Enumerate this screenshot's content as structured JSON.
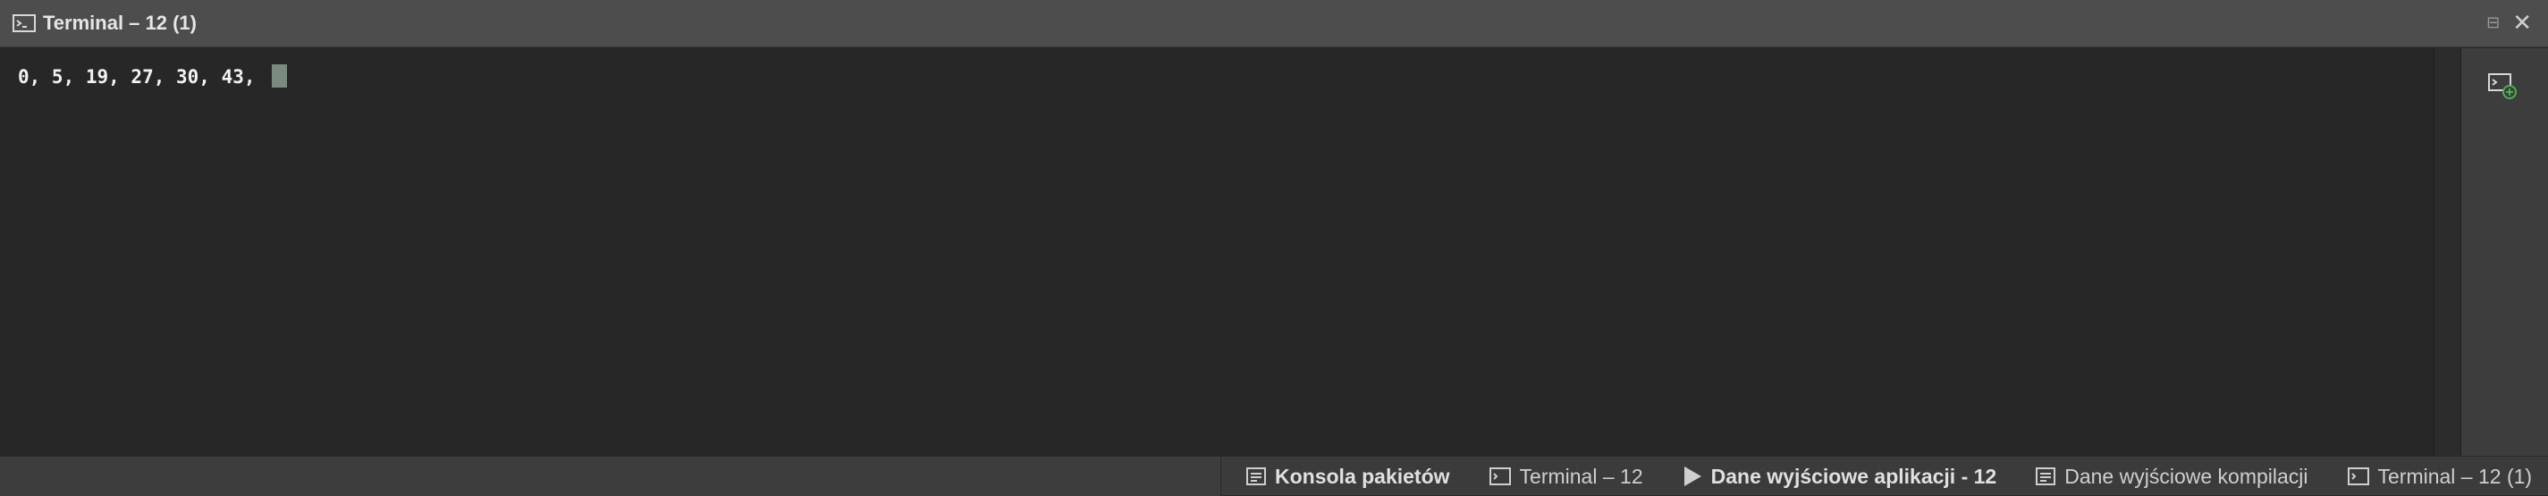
{
  "window": {
    "title": "Terminal – 12 (1)",
    "pin_glyph": "⊟",
    "close_glyph": "✕"
  },
  "terminal": {
    "output": "0, 5, 19, 27, 30, 43, "
  },
  "bottom_tabs": [
    {
      "label": "Konsola pakietów",
      "icon": "package-console-icon",
      "bold": true
    },
    {
      "label": "Terminal – 12",
      "icon": "terminal-icon",
      "bold": false
    },
    {
      "label": "Dane wyjściowe aplikacji - 12",
      "icon": "play-icon",
      "bold": true
    },
    {
      "label": "Dane wyjściowe kompilacji",
      "icon": "build-output-icon",
      "bold": false
    },
    {
      "label": "Terminal – 12 (1)",
      "icon": "terminal-icon",
      "bold": false
    }
  ],
  "colors": {
    "background": "#272727",
    "titlebar": "#4d4d4d",
    "cursor": "#7b8a80",
    "new_terminal_accent": "#4caf50"
  }
}
